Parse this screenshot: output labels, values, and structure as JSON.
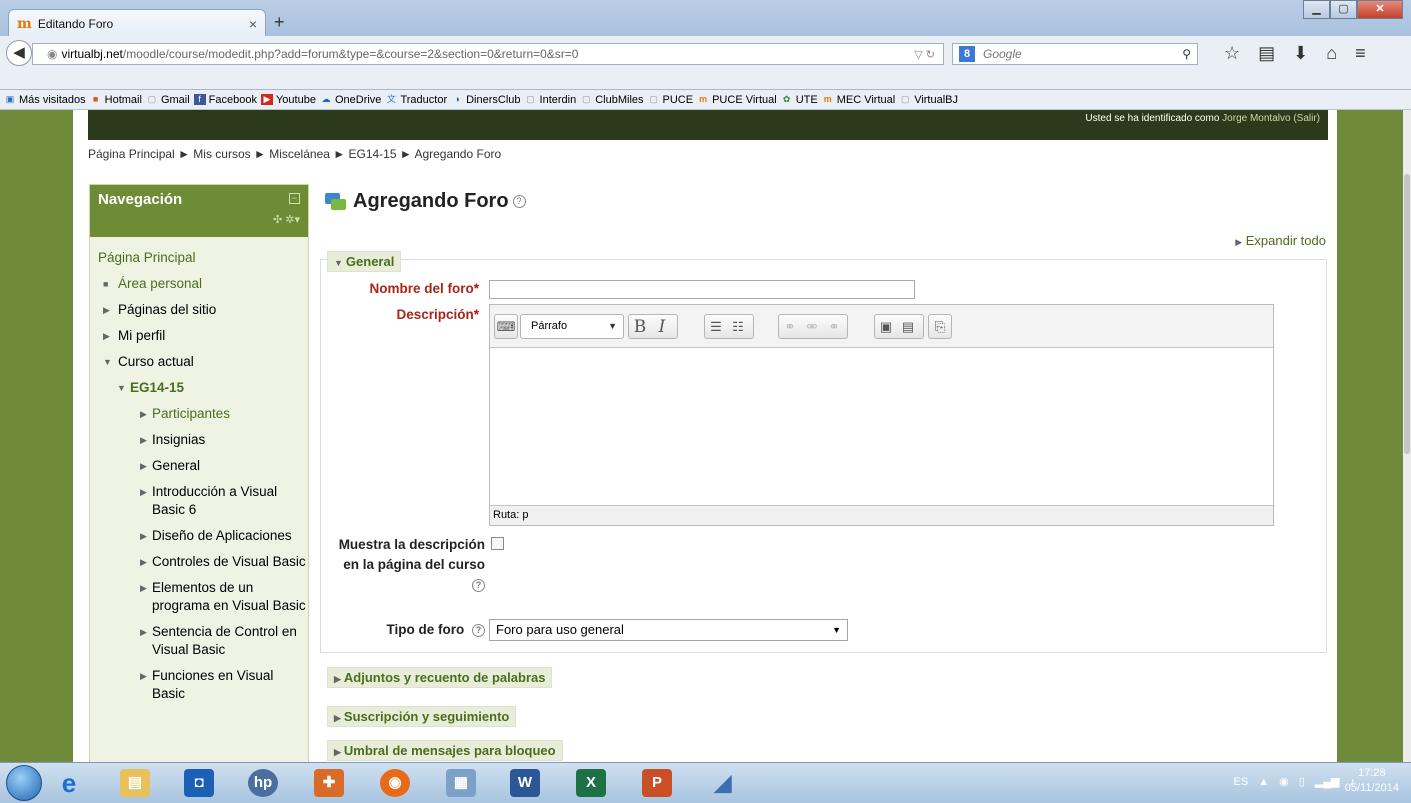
{
  "browser": {
    "tab_title": "Editando Foro",
    "tab_close": "×",
    "new_tab": "+",
    "url_host": "virtualbj.net",
    "url_path": "/moodle/course/modedit.php?add=forum&type=&course=2&section=0&return=0&sr=0",
    "search_placeholder": "Google",
    "bookmarks": [
      {
        "label": "Más visitados",
        "icon": "most-visited-icon"
      },
      {
        "label": "Hotmail",
        "icon": "windows-logo-icon"
      },
      {
        "label": "Gmail",
        "icon": "page-icon"
      },
      {
        "label": "Facebook",
        "icon": "facebook-icon"
      },
      {
        "label": "Youtube",
        "icon": "youtube-icon"
      },
      {
        "label": "OneDrive",
        "icon": "onedrive-icon"
      },
      {
        "label": "Traductor",
        "icon": "translator-icon"
      },
      {
        "label": "DinersClub",
        "icon": "diners-icon"
      },
      {
        "label": "Interdin",
        "icon": "page-icon"
      },
      {
        "label": "ClubMiles",
        "icon": "page-icon"
      },
      {
        "label": "PUCE",
        "icon": "page-icon"
      },
      {
        "label": "PUCE Virtual",
        "icon": "moodle-icon"
      },
      {
        "label": "UTE",
        "icon": "ute-icon"
      },
      {
        "label": "MEC Virtual",
        "icon": "moodle-icon"
      },
      {
        "label": "VirtualBJ",
        "icon": "page-icon"
      }
    ]
  },
  "header": {
    "login_prefix": "Usted se ha identificado como",
    "user_name": "Jorge Montalvo",
    "logout": "(Salir)"
  },
  "breadcrumb": {
    "items": [
      "Página Principal",
      "Mis cursos",
      "Miscelánea",
      "EG14-15",
      "Agregando Foro"
    ],
    "separator": "►"
  },
  "navigation": {
    "title": "Navegación",
    "home": "Página Principal",
    "items": [
      "Área personal",
      "Páginas del sitio",
      "Mi perfil",
      "Curso actual",
      "EG14-15",
      "Participantes",
      "Insignias",
      "General",
      "Introducción a Visual Basic 6",
      "Diseño de Aplicaciones",
      "Controles de Visual Basic",
      "Elementos de un programa en Visual Basic",
      "Sentencia de Control en Visual Basic",
      "Funciones en Visual Basic"
    ]
  },
  "main": {
    "title": "Agregando Foro",
    "expand_all": "Expandir todo",
    "general_legend": "General",
    "name_label": "Nombre del foro",
    "name_value": "",
    "description_label": "Descripción",
    "paragraph_format": "Párrafo",
    "editor_path": "Ruta: p",
    "show_description_label": "Muestra la descripción en la página del curso",
    "show_description_checked": false,
    "forum_type_label": "Tipo de foro",
    "forum_type_value": "Foro para uso general",
    "sections": [
      "Adjuntos y recuento de palabras",
      "Suscripción y seguimiento",
      "Umbral de mensajes para bloqueo"
    ]
  },
  "taskbar": {
    "lang": "ES",
    "time": "17:28",
    "date": "05/11/2014"
  },
  "colors": {
    "nav_green": "#6d8c35",
    "link_green": "#4b6d1e",
    "header_dark": "#2b3a1b",
    "required_red": "#a6271a"
  }
}
